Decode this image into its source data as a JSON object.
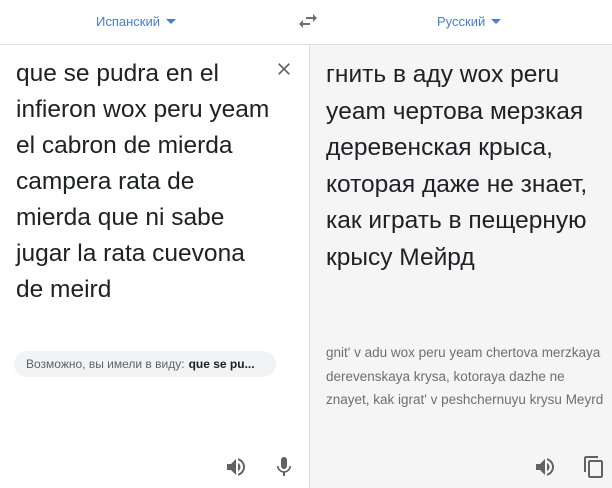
{
  "language_bar": {
    "source_language": "Испанский",
    "target_language": "Русский"
  },
  "source_panel": {
    "text": "que se pudra en el infieron wox peru yeam el cabron de mierda campera rata de mierda que ni sabe jugar la rata cuevona de meird",
    "suggestion_prefix": "Возможно, вы имели в виду:",
    "suggestion_text": "que se pu..."
  },
  "target_panel": {
    "translation": "гнить в аду wox peru yeam чертова мерзкая деревенская крыса, которая даже не знает, как играть в пещерную крысу Мейрд",
    "transliteration": "gnit' v adu wox peru yeam chertova merzkaya derevenskaya krysa, kotoraya dazhe ne znayet, kak igrat' v peshchernuyu krysu Meyrd"
  },
  "icons": {
    "swap": "swap-arrows-icon",
    "clear": "close-icon",
    "source_listen": "speaker-icon",
    "microphone": "microphone-icon",
    "target_listen": "speaker-icon",
    "copy": "copy-icon"
  },
  "colors": {
    "accent": "#4a7ccf",
    "icon": "#5f6368",
    "target_panel_bg": "#f5f5f5"
  }
}
